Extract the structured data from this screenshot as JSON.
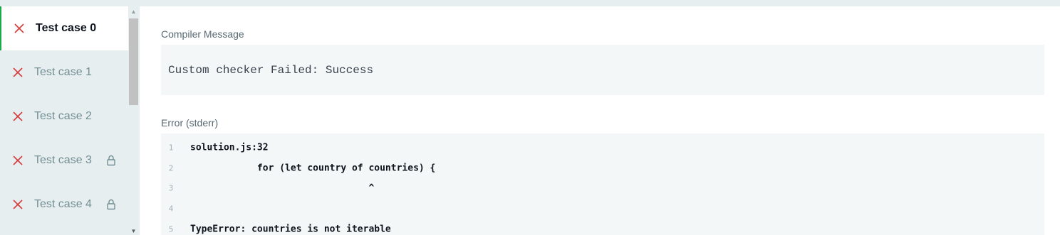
{
  "sidebar": {
    "tabs": [
      {
        "label": "Test case 0",
        "status": "failed",
        "locked": false,
        "active": true
      },
      {
        "label": "Test case 1",
        "status": "failed",
        "locked": false,
        "active": false
      },
      {
        "label": "Test case 2",
        "status": "failed",
        "locked": false,
        "active": false
      },
      {
        "label": "Test case 3",
        "status": "failed",
        "locked": true,
        "active": false
      },
      {
        "label": "Test case 4",
        "status": "failed",
        "locked": true,
        "active": false
      }
    ],
    "scroll_up_glyph": "▲",
    "scroll_down_glyph": "▼"
  },
  "compiler": {
    "label": "Compiler Message",
    "message": "Custom checker Failed: Success"
  },
  "stderr": {
    "label": "Error (stderr)",
    "lines": [
      {
        "n": "1",
        "text": "solution.js:32"
      },
      {
        "n": "2",
        "text": "            for (let country of countries) {"
      },
      {
        "n": "3",
        "text": "                                ^"
      },
      {
        "n": "4",
        "text": ""
      },
      {
        "n": "5",
        "text": "TypeError: countries is not iterable"
      }
    ]
  },
  "colors": {
    "fail_icon": "#d63b3b",
    "active_border": "#1ba94c",
    "sidebar_bg": "#e7eef0",
    "code_bg": "#f3f7f7"
  },
  "icons": {
    "fail": "close-x-icon",
    "lock": "lock-icon"
  }
}
